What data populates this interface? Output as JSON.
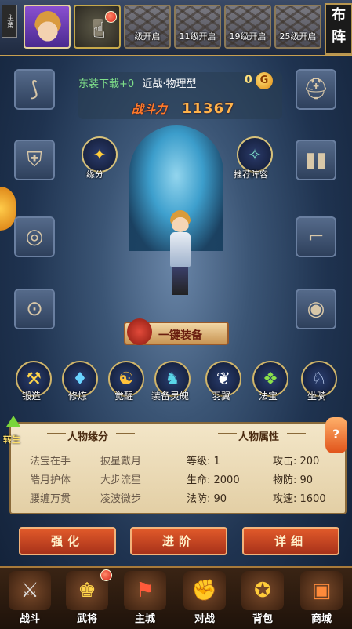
{
  "topbar": {
    "role_tab": "主角",
    "slots": [
      {
        "label": "级开启"
      },
      {
        "label": "11级开启"
      },
      {
        "label": "19级开启"
      },
      {
        "label": "25级开启"
      }
    ],
    "formation_label": "布阵"
  },
  "hero": {
    "dye_text": "东装下载+0",
    "subtitle": "近战·物理型",
    "coin_count": "0",
    "coin_symbol": "G",
    "power_label": "战斗力",
    "power_value": "11367"
  },
  "round_buttons": {
    "fate": "缘分",
    "lineup": "推荐阵容"
  },
  "equip_all_label": "一键装备",
  "functions": [
    {
      "label": "锻造",
      "icon": "hammer-icon"
    },
    {
      "label": "修炼",
      "icon": "crystal-icon"
    },
    {
      "label": "觉醒",
      "icon": "dragon-icon"
    },
    {
      "label": "装备灵魄",
      "icon": "beast-icon"
    },
    {
      "label": "羽翼",
      "icon": "wings-icon"
    },
    {
      "label": "法宝",
      "icon": "treasure-icon"
    },
    {
      "label": "坐骑",
      "icon": "unicorn-icon"
    }
  ],
  "info": {
    "rebirth_label": "转生",
    "fate_tab": "人物缘分",
    "attr_tab": "人物属性",
    "fate_items": [
      "法宝在手",
      "披星戴月",
      "皓月护体",
      "大步流星",
      "腰缠万贯",
      "凌波微步"
    ],
    "attrs": [
      "等级: 1",
      "攻击: 200",
      "生命: 2000",
      "物防: 90",
      "法防: 90",
      "攻速: 1600"
    ],
    "lantern": "?"
  },
  "actions": [
    "强化",
    "进阶",
    "详细"
  ],
  "nav": [
    {
      "label": "战斗",
      "icon": "sword-icon"
    },
    {
      "label": "武将",
      "icon": "general-icon"
    },
    {
      "label": "主城",
      "icon": "city-icon"
    },
    {
      "label": "对战",
      "icon": "glove-icon"
    },
    {
      "label": "背包",
      "icon": "bag-icon"
    },
    {
      "label": "商城",
      "icon": "chest-icon"
    }
  ]
}
